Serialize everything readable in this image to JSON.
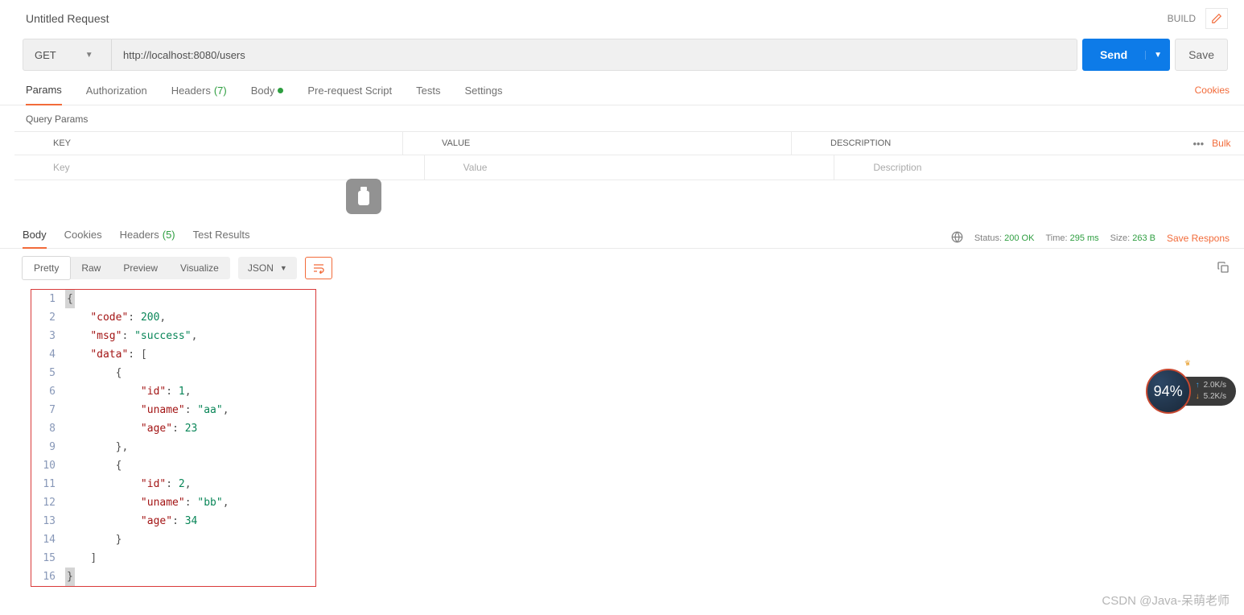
{
  "header": {
    "title": "Untitled Request",
    "build_label": "BUILD"
  },
  "request": {
    "method": "GET",
    "url": "http://localhost:8080/users",
    "send_label": "Send",
    "save_label": "Save"
  },
  "tabs": {
    "params": "Params",
    "authorization": "Authorization",
    "headers": "Headers",
    "headers_count": "(7)",
    "body": "Body",
    "prerequest": "Pre-request Script",
    "tests": "Tests",
    "settings": "Settings",
    "cookies": "Cookies"
  },
  "params": {
    "section_title": "Query Params",
    "col_key": "KEY",
    "col_value": "VALUE",
    "col_description": "DESCRIPTION",
    "bulk": "Bulk",
    "ph_key": "Key",
    "ph_value": "Value",
    "ph_description": "Description"
  },
  "response": {
    "tabs": {
      "body": "Body",
      "cookies": "Cookies",
      "headers": "Headers",
      "headers_count": "(5)",
      "test_results": "Test Results"
    },
    "meta": {
      "status_label": "Status:",
      "status_value": "200 OK",
      "time_label": "Time:",
      "time_value": "295 ms",
      "size_label": "Size:",
      "size_value": "263 B",
      "save": "Save Respons"
    },
    "viewer": {
      "pretty": "Pretty",
      "raw": "Raw",
      "preview": "Preview",
      "visualize": "Visualize",
      "format": "JSON"
    },
    "body_json": {
      "code": 200,
      "msg": "success",
      "data": [
        {
          "id": 1,
          "uname": "aa",
          "age": 23
        },
        {
          "id": 2,
          "uname": "bb",
          "age": 34
        }
      ]
    }
  },
  "float": {
    "percent": "94%",
    "up": "2.0K/s",
    "down": "5.2K/s"
  },
  "footer_mark": "CSDN @Java-呆萌老师"
}
